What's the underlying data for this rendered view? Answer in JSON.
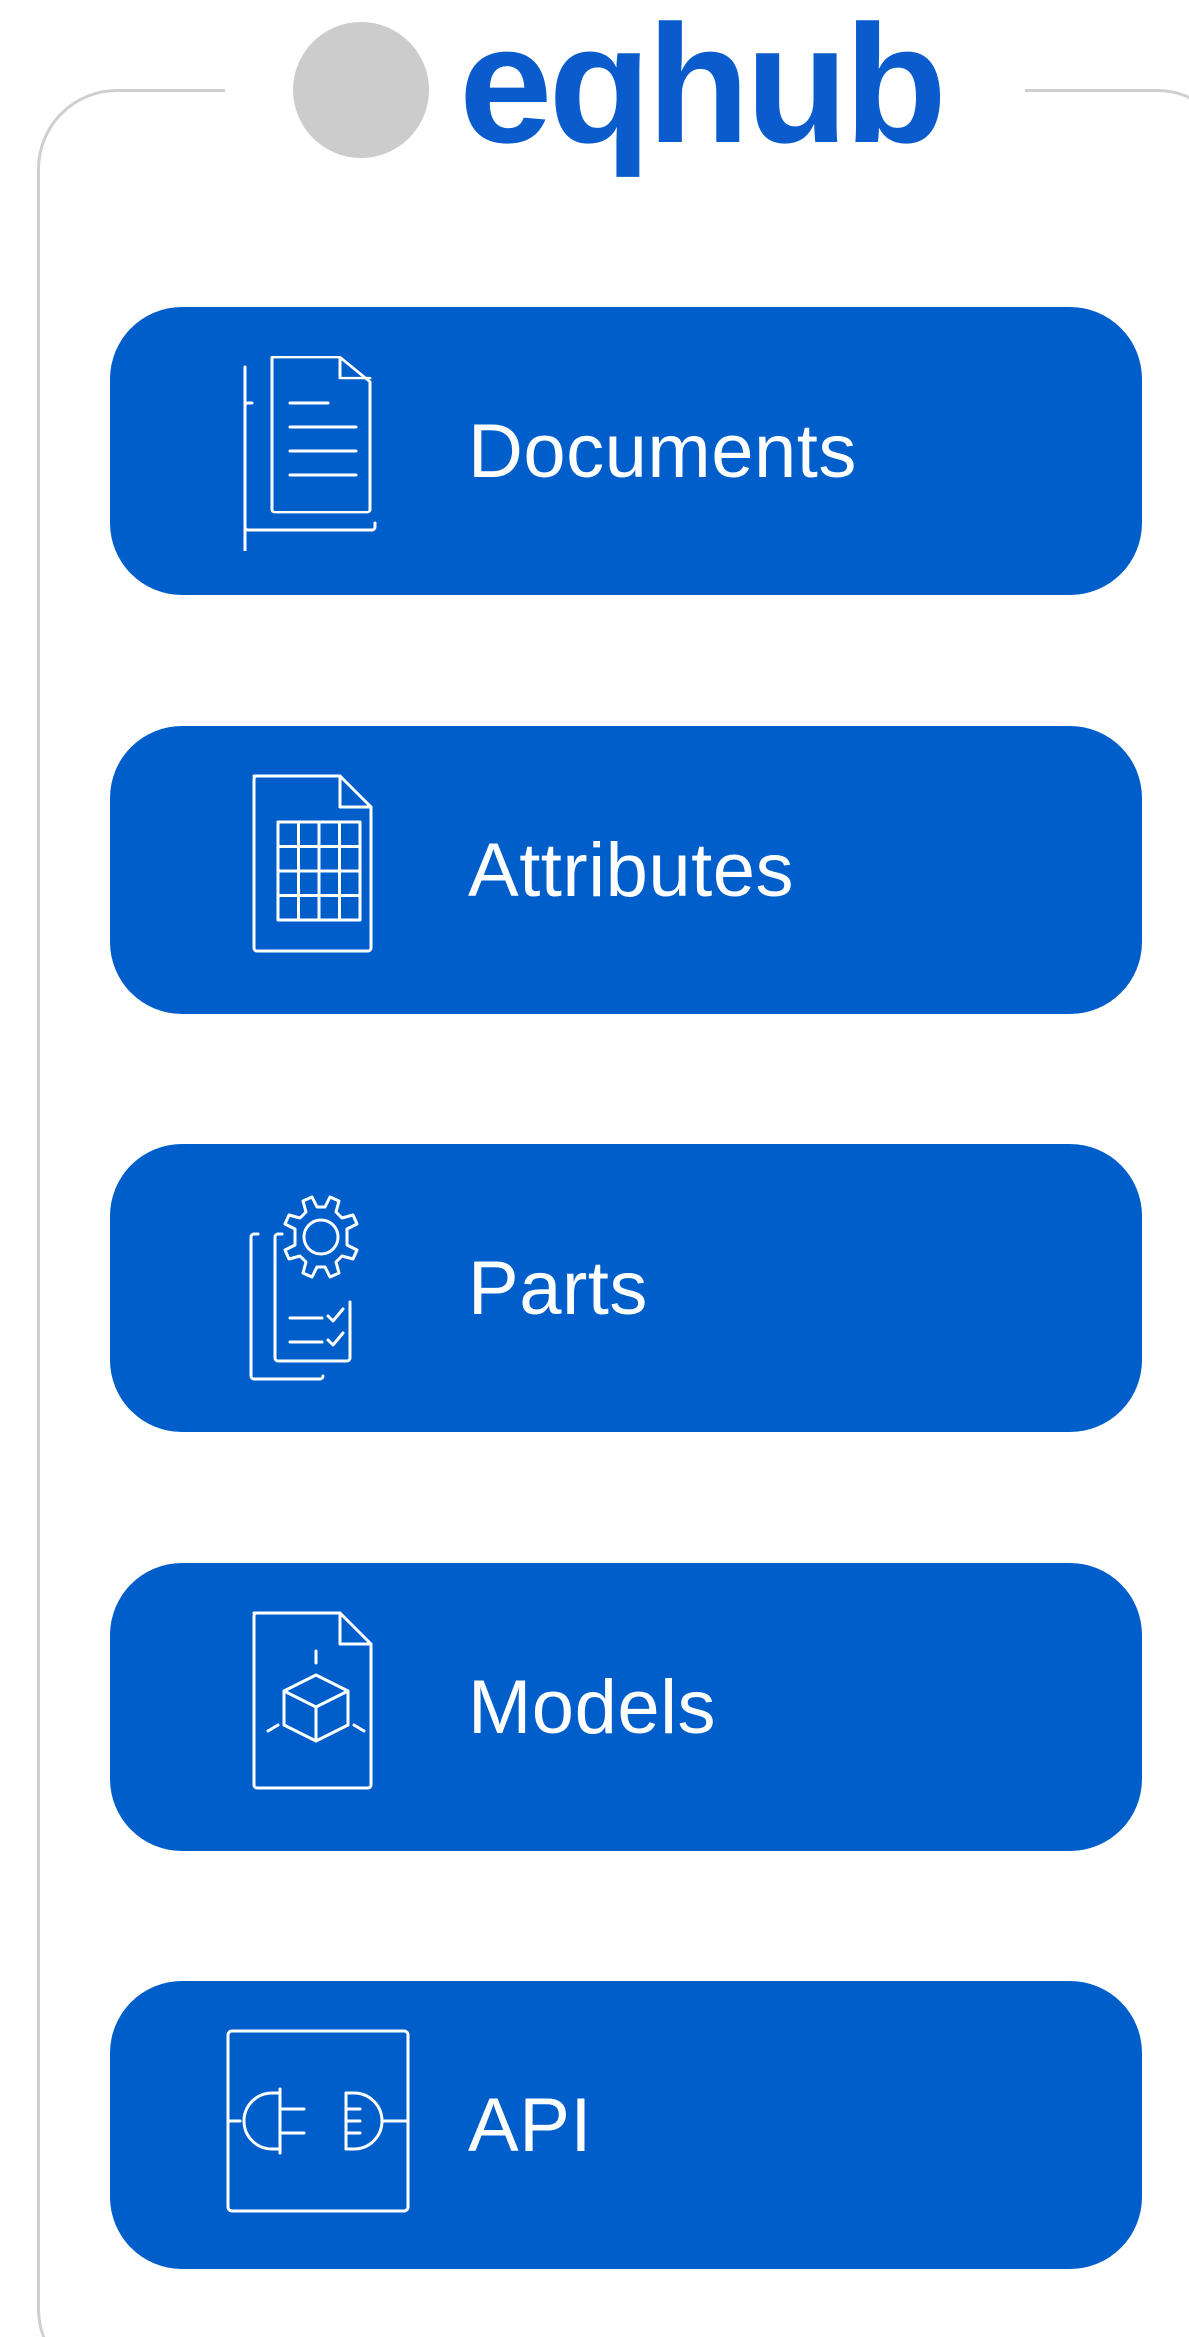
{
  "brand": {
    "name": "eqhub",
    "color": "#0a5ccc",
    "logo_dot_color": "#cccccc"
  },
  "tiles": [
    {
      "label": "Documents",
      "icon": "documents-icon"
    },
    {
      "label": "Attributes",
      "icon": "attributes-table-icon"
    },
    {
      "label": "Parts",
      "icon": "parts-gear-icon"
    },
    {
      "label": "Models",
      "icon": "models-cube-icon"
    },
    {
      "label": "API",
      "icon": "api-connector-icon"
    }
  ],
  "colors": {
    "tile_background": "#005ecb",
    "tile_text": "#ffffff",
    "frame_border": "#cfcfcf"
  }
}
